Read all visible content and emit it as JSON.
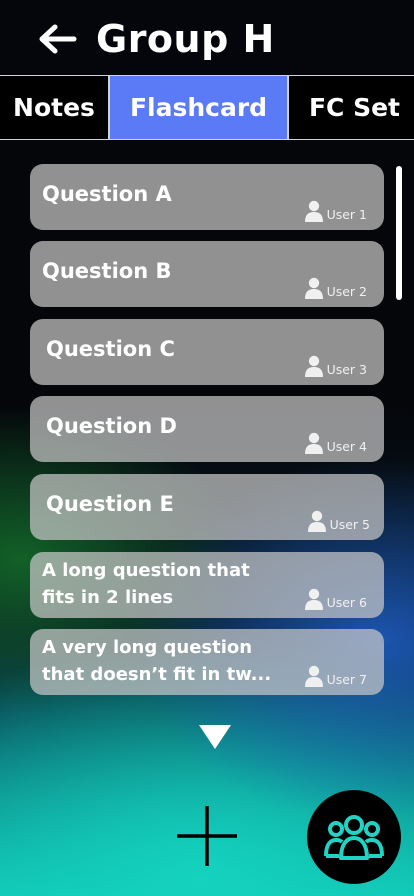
{
  "header": {
    "title": "Group H"
  },
  "tabs": [
    {
      "label": "Notes"
    },
    {
      "label": "Flashcard"
    },
    {
      "label": "FC Set"
    }
  ],
  "flashcards": [
    {
      "question": "Question A",
      "user": "User 1"
    },
    {
      "question": "Question B",
      "user": "User 2"
    },
    {
      "question": "Question C",
      "user": "User 3"
    },
    {
      "question": "Question D",
      "user": "User 4"
    },
    {
      "question": "Question E",
      "user": "User 5"
    },
    {
      "question": "A long question that fits in 2 lines",
      "user": "User 6"
    },
    {
      "question": "A very long question that doesn’t fit in tw...",
      "user": "User 7"
    }
  ],
  "colors": {
    "active_tab": "#5b7bf6",
    "card": "#c8c8c8",
    "accent": "#20d0c0"
  },
  "icons": {
    "back": "arrow-left-icon",
    "user": "user-icon",
    "more": "triangle-down-icon",
    "add": "plus-icon",
    "group": "group-icon"
  }
}
